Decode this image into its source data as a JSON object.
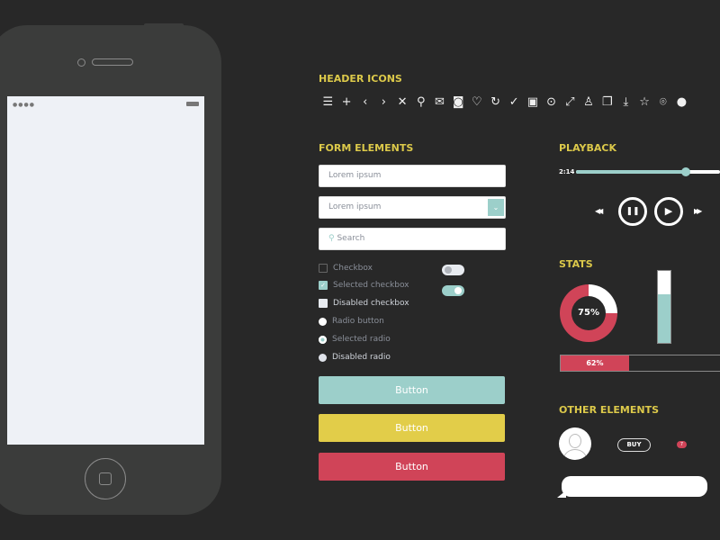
{
  "phone": {
    "signal": "●●●●"
  },
  "header_icons": {
    "title": "HEADER ICONS",
    "icons": [
      "☰",
      "+",
      "‹",
      "›",
      "✕",
      "⚲",
      "✉",
      "◙",
      "♡",
      "↻",
      "✓",
      "▣",
      "⊙",
      "⤢",
      "♙",
      "❐",
      "⤓",
      "☆",
      "⌾",
      "●"
    ],
    "icon_names": [
      "menu-icon",
      "plus-icon",
      "chevron-left-icon",
      "chevron-right-icon",
      "close-icon",
      "search-icon",
      "mail-icon",
      "camera-icon",
      "heart-icon",
      "refresh-icon",
      "check-icon",
      "image-icon",
      "target-icon",
      "expand-icon",
      "user-icon",
      "copy-icon",
      "download-icon",
      "star-icon",
      "location-icon",
      "pin-icon"
    ]
  },
  "form": {
    "title": "FORM ELEMENTS",
    "text_placeholder": "Lorem ipsum",
    "dropdown_value": "Lorem ipsum",
    "dropdown_icon": "⌄",
    "search_placeholder": "Search",
    "search_icon": "⚲",
    "checkbox": "Checkbox",
    "selected_checkbox": "Selected checkbox",
    "disabled_checkbox": "Disabled checkbox",
    "radio": "Radio button",
    "selected_radio": "Selected radio",
    "disabled_radio": "Disabled radio",
    "toggle_off": false,
    "toggle_on": true,
    "buttons": [
      {
        "label": "Button",
        "color": "#9ccfca"
      },
      {
        "label": "Button",
        "color": "#e2cd49"
      },
      {
        "label": "Button",
        "color": "#d04458"
      }
    ]
  },
  "playback": {
    "title": "PLAYBACK",
    "time": "2:14",
    "progress": 0.76,
    "rewind": "◀◀",
    "pause": "❚❚",
    "play": "▶",
    "forward": "▶▶"
  },
  "stats": {
    "title": "STATS",
    "donut_label": "75%",
    "donut_value": 0.75,
    "vertical_value": 0.68,
    "bar_label": "62%",
    "bar_value": 0.62
  },
  "other": {
    "title": "OTHER ELEMENTS",
    "buy_label": "BUY",
    "badge": "7"
  },
  "colors": {
    "accent": "#9ccfca",
    "yellow": "#e2cd49",
    "red": "#d04458",
    "heading": "#dcc94a"
  }
}
